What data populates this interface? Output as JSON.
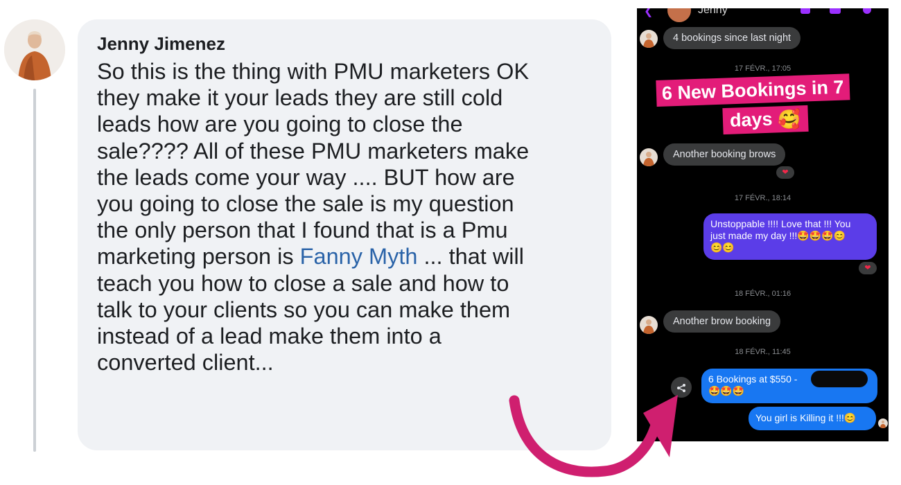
{
  "comment": {
    "author": "Jenny Jimenez",
    "lines": [
      "So this is the thing with PMU marketers OK",
      "they make it your leads they are still cold",
      "leads how are you going to close the",
      "sale???? All of these PMU marketers make",
      "the leads come your way .... BUT how are",
      "you going to close the sale is my question",
      "the only person that I found that is a Pmu"
    ],
    "line_mention_before": "marketing person is ",
    "mention": "Fanny Myth",
    "line_mention_after": " ... that will",
    "lines_after": [
      "teach you how to close a sale and how to",
      "talk to your clients so you can make them",
      "instead of a lead make them into a",
      "converted client..."
    ]
  },
  "chat": {
    "contact_name": "Jenny",
    "messages": {
      "m1": "4 bookings since last night",
      "ts1": "17 FÉVR., 17:05",
      "m2": "Another booking brows",
      "ts2": "17 FÉVR., 18:14",
      "m3_line1": "Unstoppable !!!! Love that !!! You",
      "m3_line2": "just made my day !!!",
      "ts3": "18 FÉVR., 01:16",
      "m4": "Another brow booking",
      "ts4": "18 FÉVR., 11:45",
      "m5": "6 Bookings at $550 -",
      "m6": "You girl is Killing it !!!"
    },
    "reaction_icon": "heart-icon",
    "share_icon": "share-icon"
  },
  "highlight": {
    "line1": "6 New Bookings in 7",
    "line2": "days",
    "emoji": "smiling-face-with-hearts"
  },
  "colors": {
    "accent_pink": "#e31c79",
    "messenger_purple": "#5b3de8",
    "messenger_blue": "#1877f2",
    "mention_blue": "#2a63a8"
  }
}
